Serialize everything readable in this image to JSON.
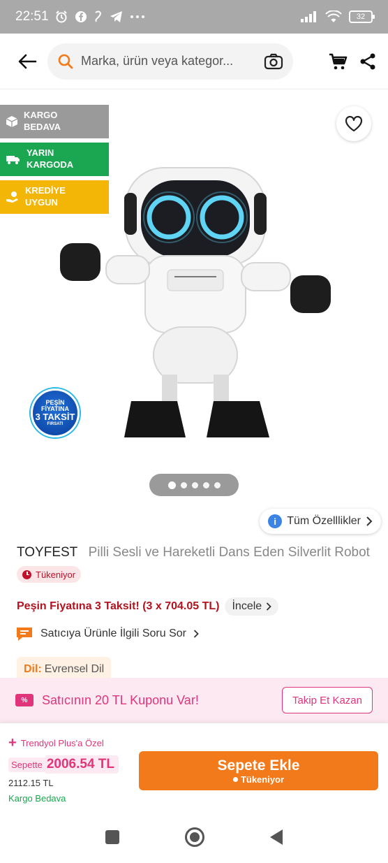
{
  "status_bar": {
    "time": "22:51",
    "battery": "32"
  },
  "search": {
    "placeholder": "Marka, ürün veya kategor..."
  },
  "badges": {
    "cargo": [
      "KARGO",
      "BEDAVA"
    ],
    "tomorrow": [
      "YARIN",
      "KARGODA"
    ],
    "credit": [
      "KREDİYE",
      "UYGUN"
    ]
  },
  "promo_circle": {
    "line1": "PEŞİN",
    "line2": "FİYATINA",
    "line3": "3 TAKSİT",
    "line4": "FIRSATI"
  },
  "gallery": {
    "image_count": 5,
    "active_index": 0
  },
  "features_button": "Tüm Özelllikler",
  "product": {
    "brand": "TOYFEST",
    "name": "Pilli Sesli ve Hareketli Dans Eden Silverlit Robot",
    "stock_status": "Tükeniyor",
    "installment_text": "Peşin Fiyatına 3 Taksit! (3 x 704.05 TL)",
    "inspect_label": "İncele",
    "ask_seller": "Satıcıya Ürünle İlgili Soru Sor",
    "language_label": "Dil:",
    "language_value": "Evrensel Dil"
  },
  "coupon": {
    "text": "Satıcının 20 TL Kuponu Var!",
    "button": "Takip Et Kazan",
    "icon": "%"
  },
  "purchase": {
    "plus_label": "Trendyol Plus'a Özel",
    "cart_label": "Sepette",
    "cart_price": "2006.54 TL",
    "old_price": "2112.15 TL",
    "shipping": "Kargo Bedava",
    "add_to_cart": "Sepete Ekle",
    "add_to_cart_sub": "Tükeniyor"
  },
  "colors": {
    "brand_orange": "#f27a1a",
    "pink": "#e0357b",
    "green": "#1ba751",
    "red": "#b3121f"
  }
}
